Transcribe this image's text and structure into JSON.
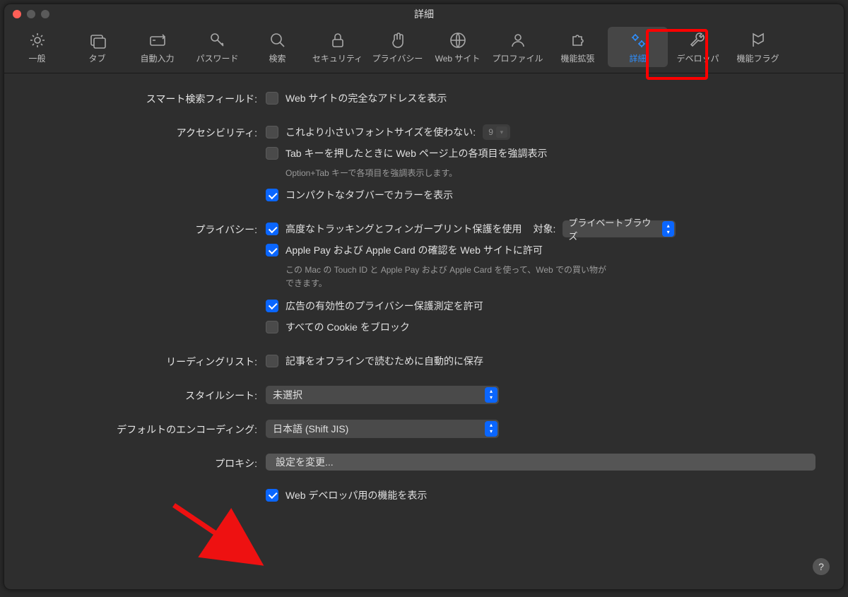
{
  "window": {
    "title": "詳細"
  },
  "toolbar": {
    "items": [
      {
        "id": "general",
        "label": "一般",
        "icon": "gear"
      },
      {
        "id": "tabs",
        "label": "タブ",
        "icon": "tabs"
      },
      {
        "id": "autofill",
        "label": "自動入力",
        "icon": "autofill"
      },
      {
        "id": "passwords",
        "label": "パスワード",
        "icon": "key"
      },
      {
        "id": "search",
        "label": "検索",
        "icon": "search"
      },
      {
        "id": "security",
        "label": "セキュリティ",
        "icon": "lock"
      },
      {
        "id": "privacy",
        "label": "プライバシー",
        "icon": "hand"
      },
      {
        "id": "websites",
        "label": "Web サイト",
        "icon": "globe"
      },
      {
        "id": "profiles",
        "label": "プロファイル",
        "icon": "profile"
      },
      {
        "id": "extensions",
        "label": "機能拡張",
        "icon": "puzzle"
      },
      {
        "id": "advanced",
        "label": "詳細",
        "icon": "gears",
        "active": true
      },
      {
        "id": "developer",
        "label": "デベロッパ",
        "icon": "wrench"
      },
      {
        "id": "flags",
        "label": "機能フラグ",
        "icon": "flag"
      }
    ]
  },
  "sections": {
    "smart_search": {
      "label": "スマート検索フィールド:",
      "show_full_address": {
        "checked": false,
        "label": "Web サイトの完全なアドレスを表示"
      }
    },
    "accessibility": {
      "label": "アクセシビリティ:",
      "min_font": {
        "checked": false,
        "label": "これより小さいフォントサイズを使わない:",
        "value": "9"
      },
      "tab_highlight": {
        "checked": false,
        "label": "Tab キーを押したときに Web ページ上の各項目を強調表示"
      },
      "tab_highlight_hint": "Option+Tab キーで各項目を強調表示します。",
      "compact_tab": {
        "checked": true,
        "label": "コンパクトなタブバーでカラーを表示"
      }
    },
    "privacy": {
      "label": "プライバシー:",
      "tracking": {
        "checked": true,
        "label": "高度なトラッキングとフィンガープリント保護を使用",
        "target_label": "対象:",
        "target_value": "プライベートブラウズ"
      },
      "apple_pay": {
        "checked": true,
        "label": "Apple Pay および Apple Card の確認を Web サイトに許可"
      },
      "apple_pay_hint": "この Mac の Touch ID と Apple Pay および Apple Card を使って、Web での買い物ができます。",
      "ad_measure": {
        "checked": true,
        "label": "広告の有効性のプライバシー保護測定を許可"
      },
      "block_cookies": {
        "checked": false,
        "label": "すべての Cookie をブロック"
      }
    },
    "reading_list": {
      "label": "リーディングリスト:",
      "save_offline": {
        "checked": false,
        "label": "記事をオフラインで読むために自動的に保存"
      }
    },
    "stylesheet": {
      "label": "スタイルシート:",
      "value": "未選択"
    },
    "encoding": {
      "label": "デフォルトのエンコーディング:",
      "value": "日本語 (Shift JIS)"
    },
    "proxy": {
      "label": "プロキシ:",
      "button": "設定を変更..."
    },
    "developer": {
      "show": {
        "checked": true,
        "label": "Web デベロッパ用の機能を表示"
      }
    }
  },
  "help": "?"
}
